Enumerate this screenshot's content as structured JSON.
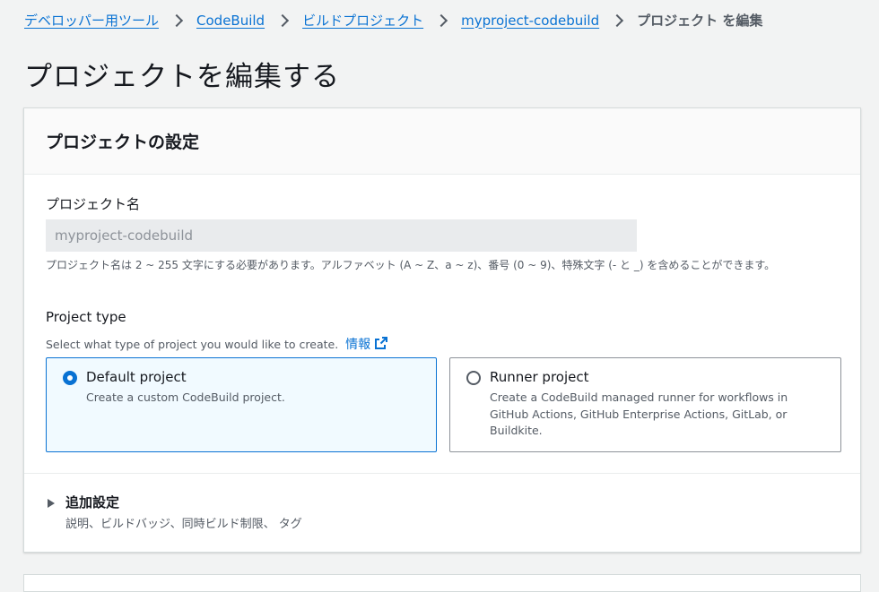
{
  "breadcrumb": {
    "items": [
      "デベロッパー用ツール",
      "CodeBuild",
      "ビルドプロジェクト",
      "myproject-codebuild"
    ],
    "current": "プロジェクト を編集"
  },
  "page": {
    "title": "プロジェクトを編集する"
  },
  "settings": {
    "title": "プロジェクトの設定",
    "name_label": "プロジェクト名",
    "name_value": "myproject-codebuild",
    "name_hint": "プロジェクト名は 2 ~ 255 文字にする必要があります。アルファベット (A ~ Z、a ~ z)、番号 (0 ~ 9)、特殊文字 (- と _) を含めることができます。",
    "type_label": "Project type",
    "type_desc": "Select what type of project you would like to create.",
    "info_link": "情報",
    "options": [
      {
        "title": "Default project",
        "desc": "Create a custom CodeBuild project.",
        "selected": true
      },
      {
        "title": "Runner project",
        "desc": "Create a CodeBuild managed runner for workflows in GitHub Actions, GitHub Enterprise Actions, GitLab, or Buildkite.",
        "selected": false
      }
    ],
    "additional": {
      "title": "追加設定",
      "desc": "説明、ビルドバッジ、同時ビルド制限、 タグ"
    }
  },
  "colors": {
    "link": "#0972d3",
    "selected_bg": "#f1faff",
    "text": "#16191f",
    "muted": "#545b64"
  },
  "icons": [
    "chevron-right-icon",
    "external-link-icon",
    "caret-right-icon"
  ]
}
